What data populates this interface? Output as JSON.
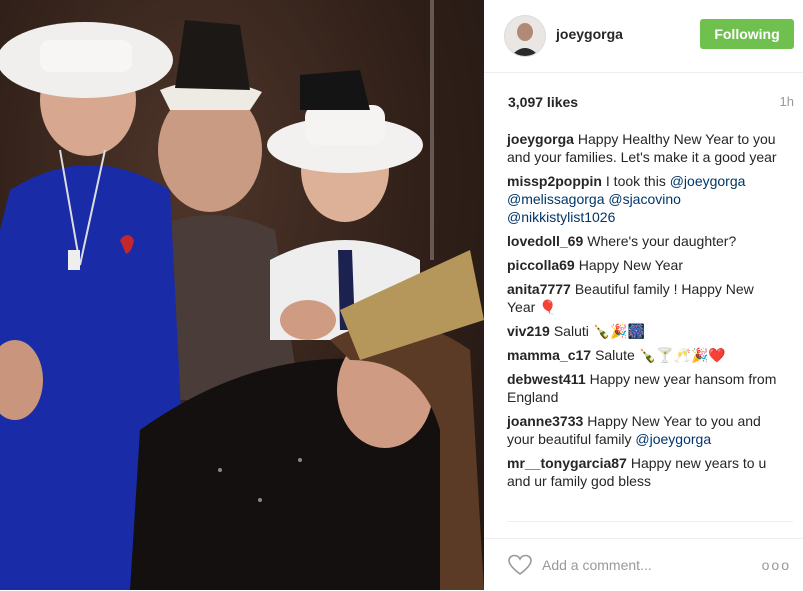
{
  "post": {
    "username": "joeygorga",
    "follow_label": "Following",
    "likes": "3,097 likes",
    "time": "1h",
    "comments": [
      {
        "user": "joeygorga",
        "text": "Happy Healthy New Year to you and your families. Let's make it a good year"
      },
      {
        "user": "missp2poppin",
        "text": "I took this ",
        "mentions": "@joeygorga @melissagorga @sjacovino @nikkistylist1026"
      },
      {
        "user": "lovedoll_69",
        "text": "Where's your daughter?"
      },
      {
        "user": "piccolla69",
        "text": "Happy New Year"
      },
      {
        "user": "anita7777",
        "text": "Beautiful family ! Happy New Year 🎈"
      },
      {
        "user": "viv219",
        "text": "Saluti 🍾🎉🎆"
      },
      {
        "user": "mamma_c17",
        "text": "Salute 🍾🍸🥂🎉❤️"
      },
      {
        "user": "debwest411",
        "text": "Happy new year hansom from England"
      },
      {
        "user": "joanne3733",
        "text": "Happy New Year to you and your beautiful family ",
        "mentions": "@joeygorga"
      },
      {
        "user": "mr__tonygarcia87",
        "text": "Happy new years to u and ur family god bless"
      }
    ],
    "add_comment_placeholder": "Add a comment...",
    "more_label": "ooo"
  },
  "colors": {
    "follow_green": "#70c050",
    "mention_blue": "#003569"
  },
  "icons": {
    "heart": "heart-icon",
    "more": "more-options-icon"
  }
}
